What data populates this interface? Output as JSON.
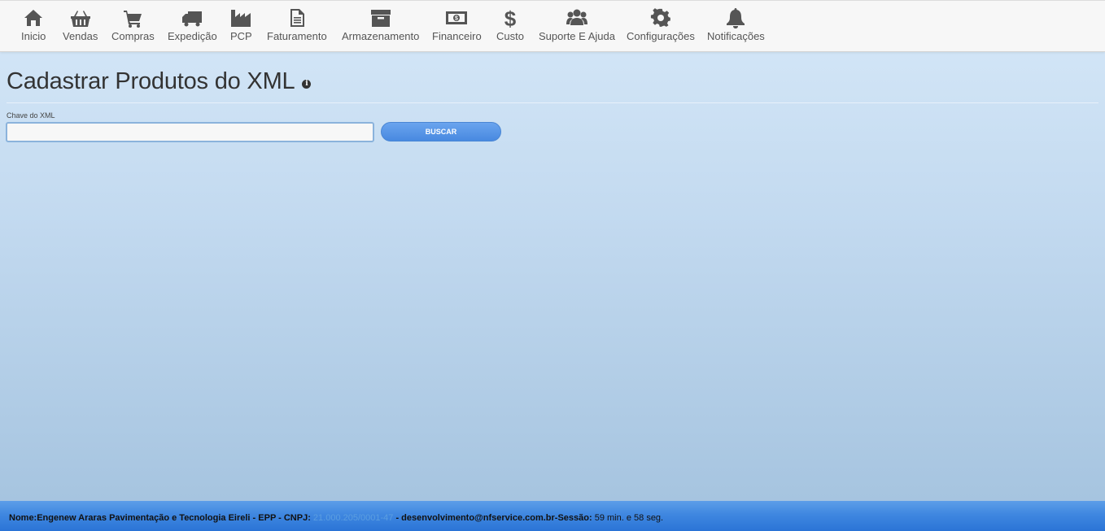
{
  "nav": {
    "items": [
      {
        "label": "Inicio",
        "icon": "home-icon"
      },
      {
        "label": "Vendas",
        "icon": "basket-icon"
      },
      {
        "label": "Compras",
        "icon": "cart-icon"
      },
      {
        "label": "Expedição",
        "icon": "truck-icon"
      },
      {
        "label": "PCP",
        "icon": "factory-icon"
      },
      {
        "label": "Faturamento",
        "icon": "document-icon"
      },
      {
        "label": "Armazenamento",
        "icon": "archive-box-icon"
      },
      {
        "label": "Financeiro",
        "icon": "money-icon"
      },
      {
        "label": "Custo",
        "icon": "dollar-icon"
      },
      {
        "label": "Suporte E Ajuda",
        "icon": "users-icon"
      },
      {
        "label": "Configurações",
        "icon": "gear-icon"
      },
      {
        "label": "Notificações",
        "icon": "bell-icon"
      }
    ]
  },
  "page": {
    "title": "Cadastrar Produtos do XML",
    "info_icon": "i"
  },
  "form": {
    "label": "Chave do XML",
    "value": "",
    "button_label": "BUSCAR"
  },
  "footer": {
    "company_prefix": "Nome:Engenew Araras Pavimentação e Tecnologia Eireli - EPP - CNPJ: ",
    "cnpj": "21.000.205/0001-47",
    "email_part": " - desenvolvimento@nfservice.com.br-Sessão: ",
    "session": "59 min. e 58 seg."
  },
  "colors": {
    "accent": "#4889e0",
    "nav_bg": "#f7f7f7",
    "footer_bg": "#3f87e0"
  }
}
